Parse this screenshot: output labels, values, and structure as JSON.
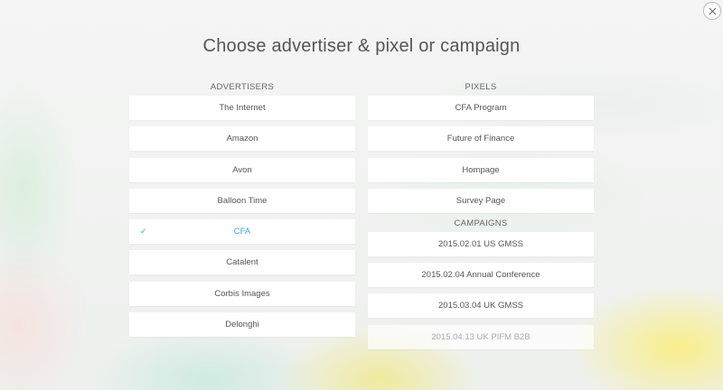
{
  "title": "Choose advertiser & pixel or campaign",
  "advertisers": {
    "header": "ADVERTISERS",
    "items": [
      {
        "label": "The Internet"
      },
      {
        "label": "Amazon"
      },
      {
        "label": "Avon"
      },
      {
        "label": "Balloon Time"
      },
      {
        "label": "CFA",
        "selected": true
      },
      {
        "label": "Catalent"
      },
      {
        "label": "Corbis Images"
      },
      {
        "label": "Delonghi"
      }
    ]
  },
  "pixels": {
    "header": "PIXELS",
    "items": [
      {
        "label": "CFA Program"
      },
      {
        "label": "Future of Finance"
      },
      {
        "label": "Hompage"
      },
      {
        "label": "Survey Page"
      }
    ]
  },
  "campaigns": {
    "header": "CAMPAIGNS",
    "items": [
      {
        "label": "2015.02.01 US GMSS"
      },
      {
        "label": "2015.02.04 Annual Conference"
      },
      {
        "label": "2015.03.04 UK GMSS"
      },
      {
        "label": "2015.04.13 UK PIFM B2B"
      }
    ]
  },
  "icons": {
    "close": "close-icon",
    "selected_check": "check-icon"
  },
  "colors": {
    "accent": "#3fa7e0",
    "text": "#555555"
  }
}
